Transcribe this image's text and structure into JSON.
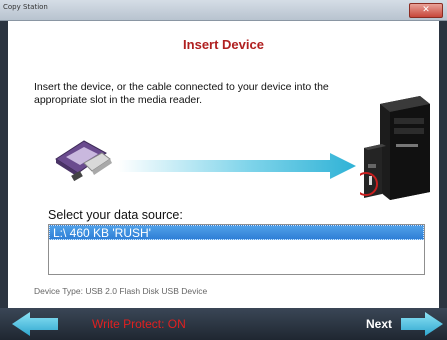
{
  "window": {
    "title": "Copy Station"
  },
  "header": {
    "title": "Insert Device"
  },
  "instructions": "Insert the device, or the cable connected to your device into the appropriate slot in the media reader.",
  "source": {
    "label": "Select your data source:",
    "items": [
      "L:\\  460 KB  'RUSH'"
    ],
    "selected_index": 0
  },
  "device_type": "Device Type: USB 2.0 Flash Disk USB Device",
  "footer": {
    "write_protect": "Write Protect: ON",
    "next_label": "Next"
  },
  "icons": {
    "back": "back-arrow-icon",
    "next": "next-arrow-icon",
    "usb": "usb-drive-icon",
    "station": "copy-station-device-icon"
  },
  "colors": {
    "title_red": "#b02020",
    "selection_blue": "#3d8ee0",
    "arrow_cyan": "#3fb8d8",
    "write_protect_red": "#e02020"
  }
}
